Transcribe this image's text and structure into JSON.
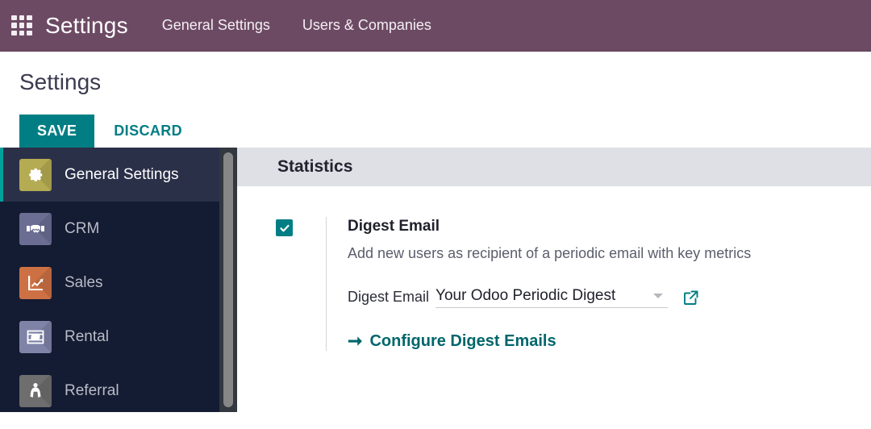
{
  "navbar": {
    "apps_icon": "apps-grid-icon",
    "brand": "Settings",
    "menu": [
      {
        "label": "General Settings"
      },
      {
        "label": "Users & Companies"
      }
    ],
    "background_color": "#6d4a64"
  },
  "page": {
    "title": "Settings",
    "save_label": "SAVE",
    "discard_label": "DISCARD",
    "accent_color": "#017e84"
  },
  "sidebar": {
    "items": [
      {
        "label": "General Settings",
        "icon": "gear-icon",
        "tile_color": "#b5ab52",
        "active": true
      },
      {
        "label": "CRM",
        "icon": "handshake-icon",
        "tile_color": "#6b6e92",
        "active": false
      },
      {
        "label": "Sales",
        "icon": "chart-arrow-icon",
        "tile_color": "#cd7144",
        "active": false
      },
      {
        "label": "Rental",
        "icon": "ticket-calendar-icon",
        "tile_color": "#7f83a8",
        "active": false
      },
      {
        "label": "Referral",
        "icon": "caped-person-icon",
        "tile_color": "#6e6e6e",
        "active": false
      }
    ]
  },
  "content": {
    "section_title": "Statistics",
    "setting": {
      "checked": true,
      "name": "Digest Email",
      "description": "Add new users as recipient of a periodic email with key metrics",
      "field_label": "Digest Email",
      "field_value": "Your Odoo Periodic Digest",
      "external_link_icon": "external-link-icon",
      "config_link_arrow": "arrow-right-icon",
      "config_link_label": "Configure Digest Emails"
    }
  }
}
